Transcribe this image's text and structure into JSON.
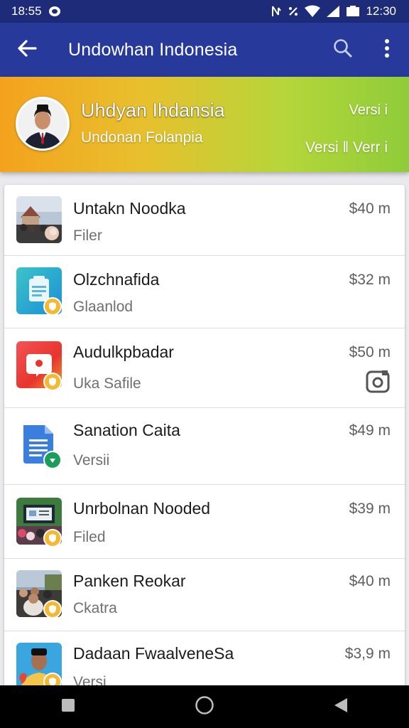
{
  "status_bar": {
    "time_left": "18:55",
    "time_right": "12:30",
    "icons": [
      "sync-icon",
      "nfc-icon",
      "vibrate-icon",
      "wifi-icon",
      "signal-icon",
      "battery-icon"
    ]
  },
  "app_bar": {
    "title": "Undowhan Indonesia",
    "icons": [
      "back-arrow-icon",
      "search-icon",
      "more-vert-icon"
    ]
  },
  "banner": {
    "name": "Uhdyan Ihdansia",
    "subtitle": "Undonan Folanpia",
    "right_top": "Versi i",
    "right_bottom": "Versi ‖ Verr i",
    "colors": {
      "start": "#f4a21e",
      "end": "#8fcc3a"
    }
  },
  "list": {
    "items": [
      {
        "name": "Untakn Noodka",
        "sub": "Filer",
        "price": "$40 m",
        "thumb": "photo-crowd-icon"
      },
      {
        "name": "Olzchnafida",
        "sub": "Glaanlod",
        "price": "$32 m",
        "thumb": "document-app-icon"
      },
      {
        "name": "Audulkpbadar",
        "sub": "Uka Safile",
        "price": "$50 m",
        "thumb": "video-app-icon",
        "trailing_icon": "camera-icon"
      },
      {
        "name": "Sanation Caita",
        "sub": "Versii",
        "price": "$49 m",
        "thumb": "docs-app-icon"
      },
      {
        "name": "Unrbolnan Nooded",
        "sub": "Filed",
        "price": "$39 m",
        "thumb": "photo-event-icon"
      },
      {
        "name": "Panken Reokar",
        "sub": "Ckatra",
        "price": "$40 m",
        "thumb": "photo-people-icon"
      },
      {
        "name": "Dadaan FwaalveneSa",
        "sub": "Versi",
        "price": "$3,9 m",
        "thumb": "photo-portrait-icon"
      }
    ]
  },
  "nav_bar": {
    "icons": [
      "recents-square-icon",
      "home-circle-icon",
      "back-triangle-icon"
    ]
  }
}
